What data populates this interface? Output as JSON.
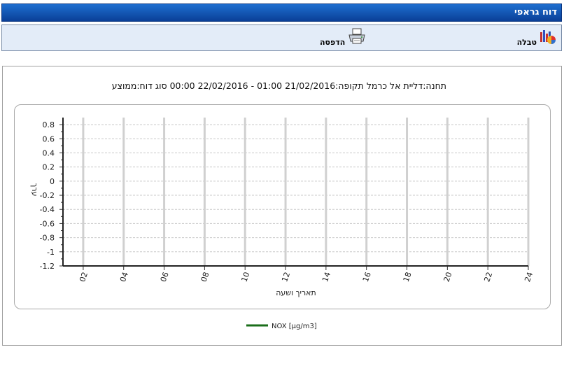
{
  "header": {
    "title": "דוח גראפי"
  },
  "toolbar": {
    "table_label": "טבלה",
    "print_label": "הדפסה"
  },
  "report": {
    "title": "תחנה:דליית אל כרמל תקופה:21/02/2016 01:00 - 22/02/2016 00:00 סוג דוח:ממוצע"
  },
  "chart_data": {
    "type": "line",
    "xlabel": "תאריך ושעה",
    "ylabel": "ערך",
    "x_ticks": [
      "02",
      "04",
      "06",
      "08",
      "10",
      "12",
      "14",
      "16",
      "18",
      "20",
      "22",
      "24"
    ],
    "y_ticks": [
      "0.8",
      "0.6",
      "0.4",
      "0.2",
      "0",
      "-0.2",
      "-0.4",
      "-0.6",
      "-0.8",
      "-1",
      "-1.2"
    ],
    "ylim": [
      -1.2,
      0.9
    ],
    "xlim": [
      1,
      24
    ],
    "grid": true,
    "legend_position": "bottom-center",
    "series": [
      {
        "name": "NOX [µg/m3]",
        "color": "#1a6e1a",
        "values": []
      }
    ]
  }
}
